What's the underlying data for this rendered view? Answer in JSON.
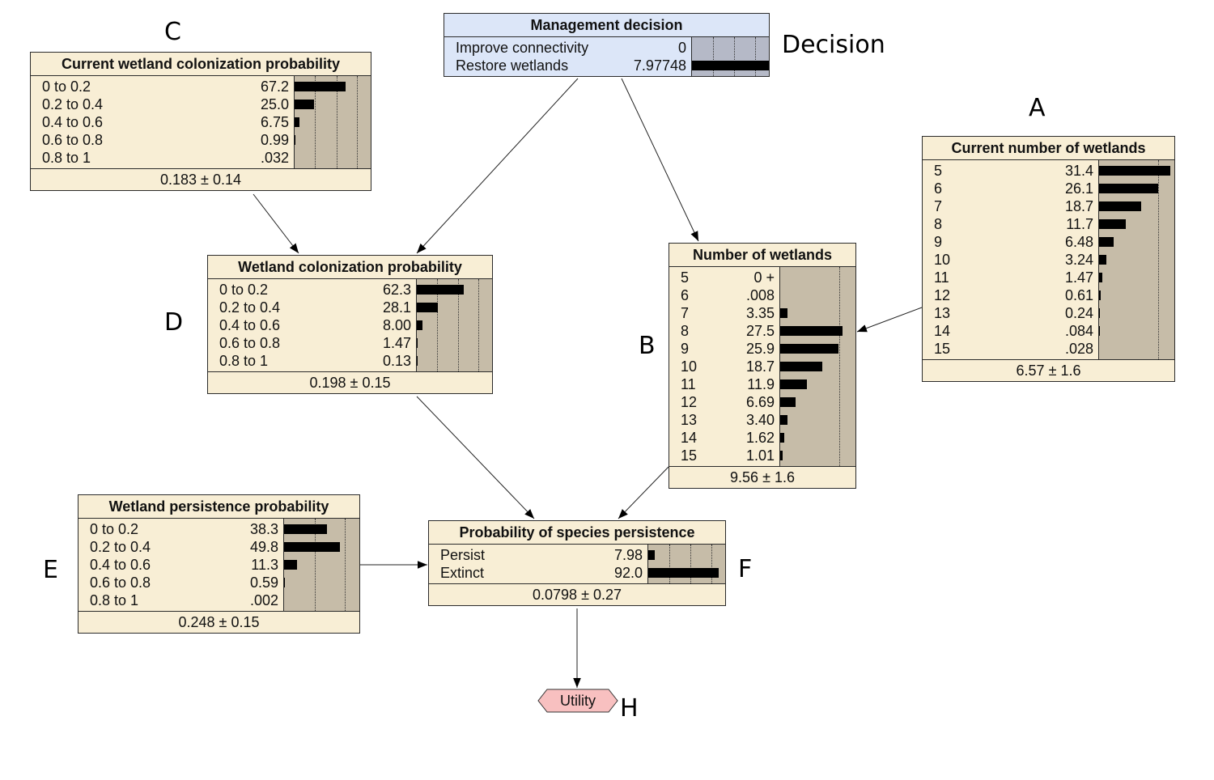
{
  "nodes": {
    "decision": {
      "title": "Management decision",
      "states": [
        {
          "label": "Improve connectivity",
          "value": "0",
          "pct": 0
        },
        {
          "label": "Restore wetlands",
          "value": "7.97748",
          "pct": 100
        }
      ]
    },
    "current_colonization": {
      "title": "Current wetland colonization probability",
      "states": [
        {
          "label": "0 to 0.2",
          "value": "67.2",
          "pct": 67.2
        },
        {
          "label": "0.2 to 0.4",
          "value": "25.0",
          "pct": 25.0
        },
        {
          "label": "0.4 to 0.6",
          "value": "6.75",
          "pct": 6.75
        },
        {
          "label": "0.6 to 0.8",
          "value": "0.99",
          "pct": 0.99
        },
        {
          "label": "0.8 to 1",
          "value": ".032",
          "pct": 0.032
        }
      ],
      "summary": "0.183 ± 0.14"
    },
    "colonization": {
      "title": "Wetland colonization probability",
      "states": [
        {
          "label": "0 to 0.2",
          "value": "62.3",
          "pct": 62.3
        },
        {
          "label": "0.2 to 0.4",
          "value": "28.1",
          "pct": 28.1
        },
        {
          "label": "0.4 to 0.6",
          "value": "8.00",
          "pct": 8.0
        },
        {
          "label": "0.6 to 0.8",
          "value": "1.47",
          "pct": 1.47
        },
        {
          "label": "0.8 to 1",
          "value": "0.13",
          "pct": 0.13
        }
      ],
      "summary": "0.198 ± 0.15"
    },
    "number_wetlands": {
      "title": "Number of wetlands",
      "states": [
        {
          "label": "5",
          "value": "0 +",
          "pct": 0
        },
        {
          "label": "6",
          "value": ".008",
          "pct": 0.008
        },
        {
          "label": "7",
          "value": "3.35",
          "pct": 3.35
        },
        {
          "label": "8",
          "value": "27.5",
          "pct": 27.5
        },
        {
          "label": "9",
          "value": "25.9",
          "pct": 25.9
        },
        {
          "label": "10",
          "value": "18.7",
          "pct": 18.7
        },
        {
          "label": "11",
          "value": "11.9",
          "pct": 11.9
        },
        {
          "label": "12",
          "value": "6.69",
          "pct": 6.69
        },
        {
          "label": "13",
          "value": "3.40",
          "pct": 3.4
        },
        {
          "label": "14",
          "value": "1.62",
          "pct": 1.62
        },
        {
          "label": "15",
          "value": "1.01",
          "pct": 1.01
        }
      ],
      "summary": "9.56 ± 1.6"
    },
    "current_number": {
      "title": "Current number of wetlands",
      "states": [
        {
          "label": "5",
          "value": "31.4",
          "pct": 31.4
        },
        {
          "label": "6",
          "value": "26.1",
          "pct": 26.1
        },
        {
          "label": "7",
          "value": "18.7",
          "pct": 18.7
        },
        {
          "label": "8",
          "value": "11.7",
          "pct": 11.7
        },
        {
          "label": "9",
          "value": "6.48",
          "pct": 6.48
        },
        {
          "label": "10",
          "value": "3.24",
          "pct": 3.24
        },
        {
          "label": "11",
          "value": "1.47",
          "pct": 1.47
        },
        {
          "label": "12",
          "value": "0.61",
          "pct": 0.61
        },
        {
          "label": "13",
          "value": "0.24",
          "pct": 0.24
        },
        {
          "label": "14",
          "value": ".084",
          "pct": 0.084
        },
        {
          "label": "15",
          "value": ".028",
          "pct": 0.028
        }
      ],
      "summary": "6.57 ± 1.6"
    },
    "persistence": {
      "title": "Wetland persistence probability",
      "states": [
        {
          "label": "0 to 0.2",
          "value": "38.3",
          "pct": 38.3
        },
        {
          "label": "0.2 to 0.4",
          "value": "49.8",
          "pct": 49.8
        },
        {
          "label": "0.4 to 0.6",
          "value": "11.3",
          "pct": 11.3
        },
        {
          "label": "0.6 to 0.8",
          "value": "0.59",
          "pct": 0.59
        },
        {
          "label": "0.8 to 1",
          "value": ".002",
          "pct": 0.002
        }
      ],
      "summary": "0.248 ± 0.15"
    },
    "species": {
      "title": "Probability of species persistence",
      "states": [
        {
          "label": "Persist",
          "value": "7.98",
          "pct": 7.98
        },
        {
          "label": "Extinct",
          "value": "92.0",
          "pct": 92.0
        }
      ],
      "summary": "0.0798 ± 0.27"
    },
    "utility": {
      "title": "Utility"
    }
  },
  "annotations": {
    "decision": "Decision",
    "A": "A",
    "B": "B",
    "C": "C",
    "D": "D",
    "E": "E",
    "F": "F",
    "H": "H"
  },
  "colors": {
    "node_fill": "#f8eed5",
    "decision_fill": "#dce6f8",
    "bar_area": "#c6bca8",
    "utility_fill": "#f8c0c0"
  }
}
